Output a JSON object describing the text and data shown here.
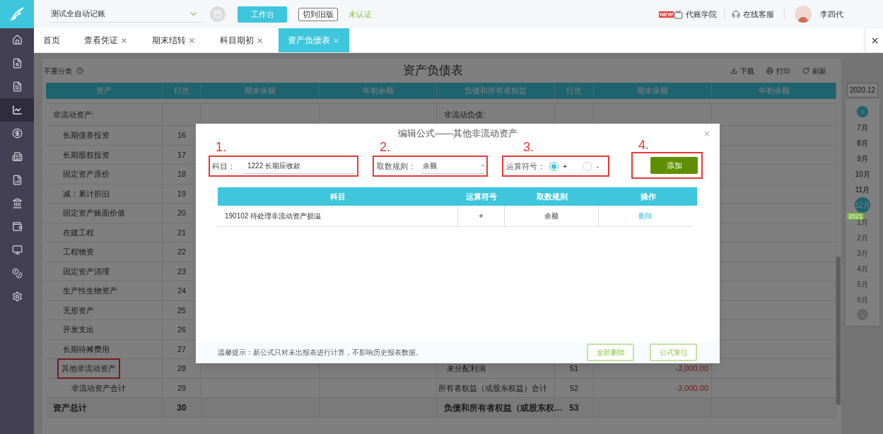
{
  "topbar": {
    "account": "测试全自动记账",
    "workbench_button": "工作台",
    "switch_button": "切到旧版",
    "status": "未认证",
    "academy": {
      "badge": "NEW",
      "label": "代账学院"
    },
    "support": "在线客服",
    "user": "李四代"
  },
  "sidebar": {
    "items": [
      {
        "selected": false
      },
      {
        "selected": false
      },
      {
        "selected": false
      },
      {
        "selected": true
      },
      {
        "selected": false
      },
      {
        "selected": false
      },
      {
        "selected": false
      },
      {
        "selected": false
      },
      {
        "selected": false
      },
      {
        "selected": false
      },
      {
        "selected": false
      },
      {
        "selected": false
      }
    ]
  },
  "tabs": [
    {
      "label": "首页",
      "closable": false,
      "selected": false
    },
    {
      "label": "查看凭证",
      "closable": true,
      "selected": false
    },
    {
      "label": "期末结转",
      "closable": true,
      "selected": false
    },
    {
      "label": "科目期初",
      "closable": true,
      "selected": false
    },
    {
      "label": "资产负债表",
      "closable": true,
      "selected": true
    }
  ],
  "report": {
    "option": "不重分类",
    "title": "资产负债表",
    "actions": [
      {
        "kind": "download",
        "label": "下载"
      },
      {
        "kind": "print",
        "label": "打印"
      },
      {
        "kind": "refresh",
        "label": "刷新"
      }
    ],
    "columns": [
      "资产",
      "行次",
      "期末余额",
      "年初余额",
      "负债和所有者权益",
      "行次",
      "期末余额",
      "年初余额"
    ],
    "rows": [
      {
        "asset": {
          "kind": "section",
          "label": "非流动资产:"
        },
        "liability": {
          "kind": "section",
          "label": "非流动负债:"
        }
      },
      {
        "asset": {
          "kind": "item",
          "label": "长期债券投资",
          "line": "16",
          "highlighted": false
        }
      },
      {
        "asset": {
          "kind": "item",
          "label": "长期股权投资",
          "line": "17",
          "highlighted": false
        }
      },
      {
        "asset": {
          "kind": "item",
          "label": "固定资产原价",
          "line": "18",
          "highlighted": false
        }
      },
      {
        "asset": {
          "kind": "item",
          "label": "减：累计折旧",
          "line": "19",
          "highlighted": false
        }
      },
      {
        "asset": {
          "kind": "item",
          "label": "固定资产账面价值",
          "line": "20",
          "highlighted": false
        }
      },
      {
        "asset": {
          "kind": "item",
          "label": "在建工程",
          "line": "21",
          "highlighted": false
        }
      },
      {
        "asset": {
          "kind": "item",
          "label": "工程物资",
          "line": "22",
          "highlighted": false
        }
      },
      {
        "asset": {
          "kind": "item",
          "label": "固定资产清理",
          "line": "23",
          "highlighted": false
        }
      },
      {
        "asset": {
          "kind": "item",
          "label": "生产性生物资产",
          "line": "24",
          "highlighted": false
        }
      },
      {
        "asset": {
          "kind": "item",
          "label": "无形资产",
          "line": "25",
          "highlighted": false
        }
      },
      {
        "asset": {
          "kind": "item",
          "label": "开发支出",
          "line": "26",
          "highlighted": false
        }
      },
      {
        "asset": {
          "kind": "item",
          "label": "长期待摊费用",
          "line": "27",
          "highlighted": false
        }
      },
      {
        "asset": {
          "kind": "item",
          "label": "其他非流动资产",
          "line": "28",
          "highlighted": true
        },
        "liability": {
          "kind": "item",
          "label": "未分配利润",
          "line": "51",
          "end_balance": "-3,000.00"
        }
      },
      {
        "asset": {
          "kind": "subtotal",
          "label": "非流动资产合计",
          "line": "29",
          "highlighted": false
        },
        "liability": {
          "kind": "subtotal",
          "label": "所有者权益（或股东权益）合计",
          "line": "52",
          "end_balance": "-3,000.00"
        }
      },
      {
        "asset": {
          "kind": "total",
          "label": "资产总计",
          "line": "30"
        },
        "liability": {
          "kind": "total",
          "label": "负债和所有者权益（或股东权…",
          "line": "53"
        }
      }
    ]
  },
  "calendar": {
    "period_button": "2020.12",
    "year_badge": "2021",
    "months": [
      {
        "label": "7月",
        "selected": false,
        "disabled": false
      },
      {
        "label": "8月",
        "selected": false,
        "disabled": false
      },
      {
        "label": "9月",
        "selected": false,
        "disabled": false
      },
      {
        "label": "10月",
        "selected": false,
        "disabled": false
      },
      {
        "label": "11月",
        "selected": false,
        "disabled": false
      },
      {
        "label": "12月",
        "selected": true,
        "disabled": false
      },
      {
        "label": "1月",
        "selected": false,
        "disabled": true
      },
      {
        "label": "2月",
        "selected": false,
        "disabled": true
      },
      {
        "label": "3月",
        "selected": false,
        "disabled": true
      },
      {
        "label": "4月",
        "selected": false,
        "disabled": true
      },
      {
        "label": "5月",
        "selected": false,
        "disabled": true
      },
      {
        "label": "6月",
        "selected": false,
        "disabled": true
      }
    ]
  },
  "dialog": {
    "title": "编辑公式——其他非流动资产",
    "steps": [
      "1.",
      "2.",
      "3.",
      "4."
    ],
    "subject": {
      "label": "科目：",
      "value": "1222 长期应收款"
    },
    "rule": {
      "label": "取数规则：",
      "value": "余额"
    },
    "operator": {
      "label": "运算符号：",
      "options": [
        {
          "label": "+",
          "selected": true
        },
        {
          "label": "-",
          "selected": false
        }
      ]
    },
    "add_button": "添加",
    "table": {
      "columns": [
        "科目",
        "运算符号",
        "取数规则",
        "操作"
      ],
      "rows": [
        {
          "subject": "190102 待处理非流动资产损溢",
          "operator": "+",
          "rule": "余额",
          "action": "删除"
        }
      ]
    },
    "hint": "温馨提示：新公式只对未出报表进行计算，不影响历史报表数据。",
    "footer_buttons": [
      "全部删除",
      "公式复位"
    ]
  }
}
